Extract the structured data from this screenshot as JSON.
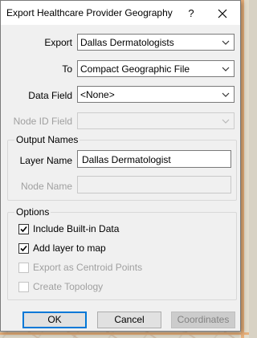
{
  "dialog": {
    "title": "Export Healthcare Provider Geography",
    "help_glyph": "?",
    "close_glyph": "✕"
  },
  "fields": {
    "export": {
      "label": "Export",
      "value": "Dallas Dermatologists"
    },
    "to": {
      "label": "To",
      "value": "Compact Geographic File"
    },
    "data_field": {
      "label": "Data Field",
      "value": "<None>"
    },
    "node_id_field": {
      "label": "Node ID Field",
      "value": ""
    }
  },
  "output_names": {
    "title": "Output Names",
    "layer_name": {
      "label": "Layer Name",
      "value": "Dallas Dermatologist"
    },
    "node_name": {
      "label": "Node Name",
      "value": ""
    }
  },
  "options": {
    "title": "Options",
    "items": [
      {
        "label": "Include Built-in Data",
        "checked": true,
        "enabled": true
      },
      {
        "label": "Add layer to map",
        "checked": true,
        "enabled": true
      },
      {
        "label": "Export as Centroid Points",
        "checked": false,
        "enabled": false
      },
      {
        "label": "Create Topology",
        "checked": false,
        "enabled": false
      }
    ]
  },
  "buttons": {
    "ok": "OK",
    "cancel": "Cancel",
    "coordinates": "Coordinates"
  },
  "colors": {
    "focus_accent": "#0078d7",
    "dialog_bg": "#f0f0f0",
    "disabled_text": "#a0a0a0"
  }
}
